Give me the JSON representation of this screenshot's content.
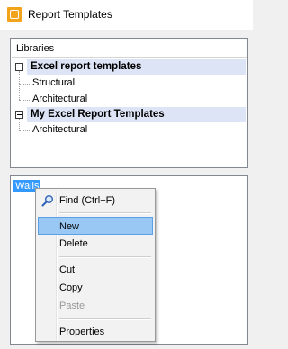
{
  "window": {
    "title": "Report Templates",
    "icon": "app-icon"
  },
  "libraries": {
    "header": "Libraries",
    "groups": [
      {
        "label": "Excel report templates",
        "expanded": true,
        "children": [
          "Structural",
          "Architectural"
        ]
      },
      {
        "label": "My Excel Report Templates",
        "expanded": true,
        "children": [
          "Architectural"
        ]
      }
    ]
  },
  "templates": {
    "selected_item": "Walls"
  },
  "context_menu": {
    "items": [
      {
        "label": "Find (Ctrl+F)",
        "icon": "search-icon",
        "enabled": true
      },
      {
        "label": "New",
        "enabled": true,
        "highlighted": true
      },
      {
        "label": "Delete",
        "enabled": true
      },
      {
        "label": "Cut",
        "enabled": true
      },
      {
        "label": "Copy",
        "enabled": true
      },
      {
        "label": "Paste",
        "enabled": false
      },
      {
        "label": "Properties",
        "enabled": true
      }
    ]
  },
  "colors": {
    "selection": "#3399ff",
    "group_row": "#dde4f6",
    "menu_highlight": "#99c8f5",
    "app_icon": "#f2a31a"
  }
}
